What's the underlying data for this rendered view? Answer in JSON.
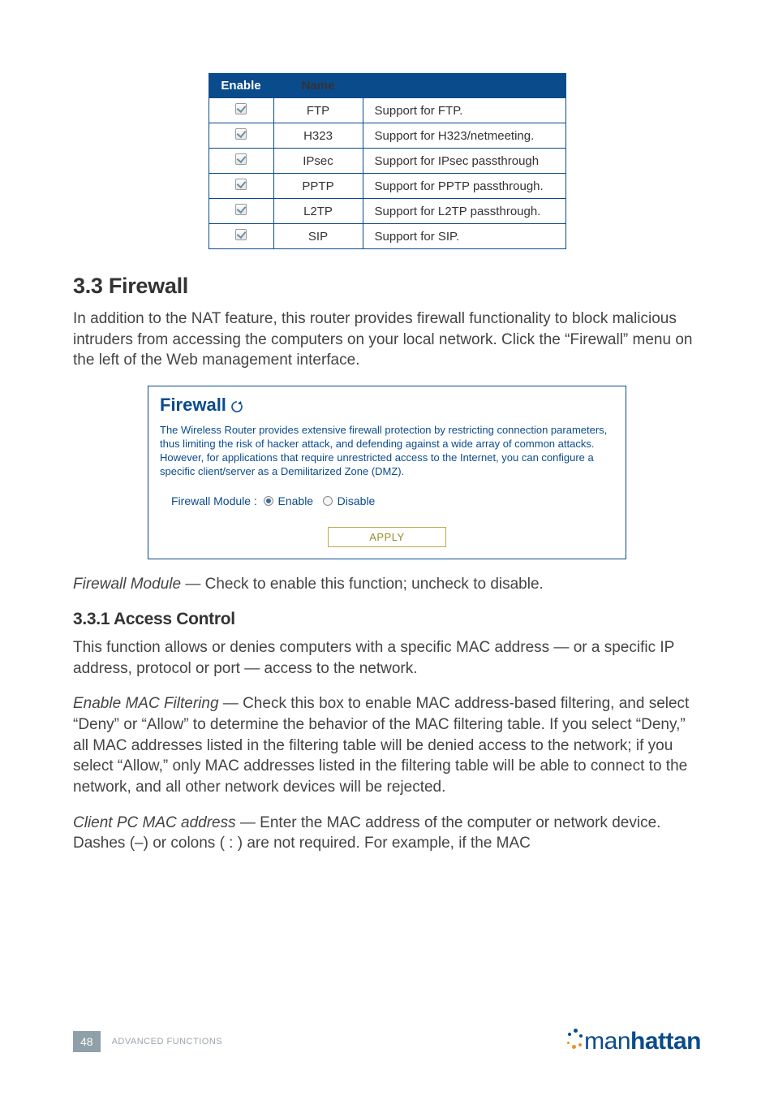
{
  "alg_table": {
    "headers": {
      "enable": "Enable",
      "name": "Name",
      "desc": ""
    },
    "rows": [
      {
        "name": "FTP",
        "desc": "Support for FTP."
      },
      {
        "name": "H323",
        "desc": "Support for H323/netmeeting."
      },
      {
        "name": "IPsec",
        "desc": "Support for IPsec passthrough"
      },
      {
        "name": "PPTP",
        "desc": "Support for PPTP passthrough."
      },
      {
        "name": "L2TP",
        "desc": "Support for L2TP passthrough."
      },
      {
        "name": "SIP",
        "desc": "Support for SIP."
      }
    ]
  },
  "section": {
    "number_title": "3.3  Firewall",
    "intro": "In addition to the NAT feature, this router provides firewall functionality to block malicious intruders from accessing the computers on your local network. Click the “Firewall” menu on the left of the Web management interface."
  },
  "firewall_panel": {
    "title": "Firewall",
    "description": "The Wireless Router provides extensive firewall protection by restricting connection parameters, thus limiting the risk of hacker attack, and defending against a wide array of common attacks. However, for applications that require unrestricted access to the Internet, you can configure a specific client/server as a Demilitarized Zone (DMZ).",
    "setting_label": "Firewall Module :",
    "option_enable": "Enable",
    "option_disable": "Disable",
    "apply_label": "APPLY"
  },
  "firewall_module_note": {
    "label": "Firewall Module",
    "text": " — Check to enable this function; uncheck to disable."
  },
  "subsection": {
    "number_title": "3.3.1  Access Control",
    "intro": "This function allows or denies computers with a specific MAC address — or a specific IP address, protocol or port — access to the network.",
    "enable_mac": {
      "label": "Enable MAC Filtering",
      "text": " — Check this box to enable MAC address-based filtering, and select “Deny” or “Allow” to determine the behavior of the MAC filtering table. If you select “Deny,” all MAC addresses listed in the filtering table will be denied access to the network; if you select “Allow,” only MAC addresses listed in the filtering table will be able to connect to the network, and all other network devices will be rejected."
    },
    "client_pc": {
      "label": "Client PC MAC address",
      "text": " — Enter the MAC address of the computer or network device. Dashes (–) or colons ( : ) are not required. For example, if the MAC"
    }
  },
  "footer": {
    "page": "48",
    "section_name": "ADVANCED FUNCTIONS",
    "brand_pre": "man",
    "brand_post": "hattan"
  }
}
